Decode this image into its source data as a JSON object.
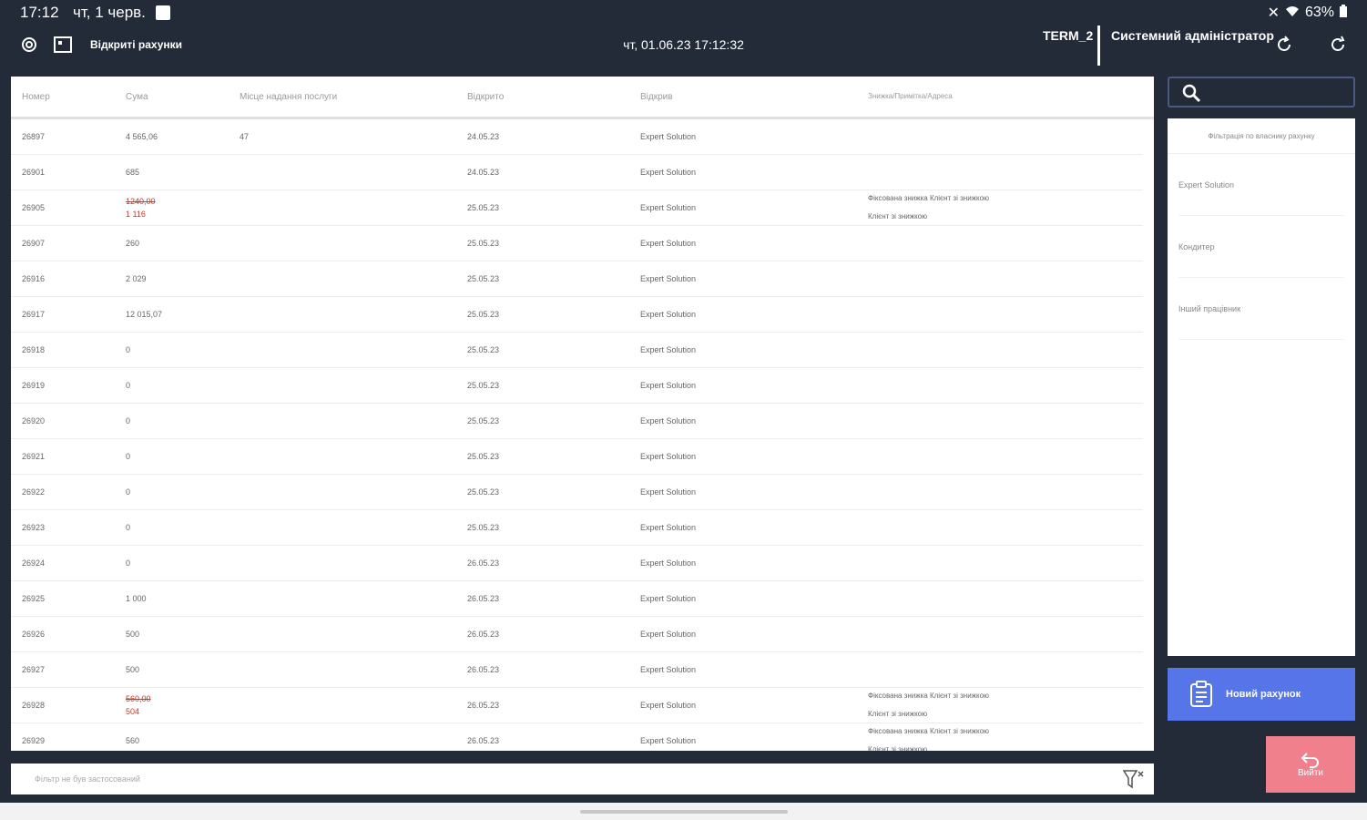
{
  "status": {
    "time": "17:12",
    "date": "чт, 1 черв.",
    "battery": "63%"
  },
  "toolbar": {
    "title": "Відкриті рахунки",
    "datetime": "чт, 01.06.23 17:12:32",
    "terminal": "TERM_2",
    "user": "Системний адміністратор"
  },
  "table": {
    "headers": [
      "Номер",
      "Сума",
      "Місце надання послуги",
      "Відкрито",
      "Відкрив",
      "Знижка/Примітка/Адреса"
    ],
    "rows": [
      {
        "num": "26897",
        "sum": "4 565,06",
        "sum_red": "",
        "place": "47",
        "date": "24.05.23",
        "by": "Expert Solution",
        "note": ""
      },
      {
        "num": "26901",
        "sum": "685",
        "sum_red": "",
        "place": "",
        "date": "24.05.23",
        "by": "Expert Solution",
        "note": ""
      },
      {
        "num": "26905",
        "sum": "1240,00",
        "sum_red": "1 116",
        "place": "",
        "date": "25.05.23",
        "by": "Expert Solution",
        "note": "Фіксована знижка Клієнт зі знижкою\nКлієнт зі знижкою"
      },
      {
        "num": "26907",
        "sum": "260",
        "sum_red": "",
        "place": "",
        "date": "25.05.23",
        "by": "Expert Solution",
        "note": ""
      },
      {
        "num": "26916",
        "sum": "2 029",
        "sum_red": "",
        "place": "",
        "date": "25.05.23",
        "by": "Expert Solution",
        "note": ""
      },
      {
        "num": "26917",
        "sum": "12 015,07",
        "sum_red": "",
        "place": "",
        "date": "25.05.23",
        "by": "Expert Solution",
        "note": ""
      },
      {
        "num": "26918",
        "sum": "0",
        "sum_red": "",
        "place": "",
        "date": "25.05.23",
        "by": "Expert Solution",
        "note": ""
      },
      {
        "num": "26919",
        "sum": "0",
        "sum_red": "",
        "place": "",
        "date": "25.05.23",
        "by": "Expert Solution",
        "note": ""
      },
      {
        "num": "26920",
        "sum": "0",
        "sum_red": "",
        "place": "",
        "date": "25.05.23",
        "by": "Expert Solution",
        "note": ""
      },
      {
        "num": "26921",
        "sum": "0",
        "sum_red": "",
        "place": "",
        "date": "25.05.23",
        "by": "Expert Solution",
        "note": ""
      },
      {
        "num": "26922",
        "sum": "0",
        "sum_red": "",
        "place": "",
        "date": "25.05.23",
        "by": "Expert Solution",
        "note": ""
      },
      {
        "num": "26923",
        "sum": "0",
        "sum_red": "",
        "place": "",
        "date": "25.05.23",
        "by": "Expert Solution",
        "note": ""
      },
      {
        "num": "26924",
        "sum": "0",
        "sum_red": "",
        "place": "",
        "date": "26.05.23",
        "by": "Expert Solution",
        "note": ""
      },
      {
        "num": "26925",
        "sum": "1 000",
        "sum_red": "",
        "place": "",
        "date": "26.05.23",
        "by": "Expert Solution",
        "note": ""
      },
      {
        "num": "26926",
        "sum": "500",
        "sum_red": "",
        "place": "",
        "date": "26.05.23",
        "by": "Expert Solution",
        "note": ""
      },
      {
        "num": "26927",
        "sum": "500",
        "sum_red": "",
        "place": "",
        "date": "26.05.23",
        "by": "Expert Solution",
        "note": ""
      },
      {
        "num": "26928",
        "sum": "560,00",
        "sum_red": "504",
        "place": "",
        "date": "26.05.23",
        "by": "Expert Solution",
        "note": "Фіксована знижка Клієнт зі знижкою\nКлієнт зі знижкою"
      },
      {
        "num": "26929",
        "sum": "560",
        "sum_red": "",
        "place": "",
        "date": "26.05.23",
        "by": "Expert Solution",
        "note": "Фіксована знижка Клієнт зі знижкою\nКлієнт зі знижкою"
      }
    ]
  },
  "filter": {
    "placeholder": "Фільтр не був застосований"
  },
  "side": {
    "header": "Фільтрація по власнику рахунку",
    "items": [
      "Expert Solution",
      "Кондитер",
      "Інший працівник"
    ]
  },
  "buttons": {
    "new_bill": "Новий рахунок",
    "exit": "Вийти"
  },
  "colors": {
    "background": "#232b38",
    "primary": "#5675e8",
    "exit": "#f0808c",
    "strike": "#c0392b"
  }
}
